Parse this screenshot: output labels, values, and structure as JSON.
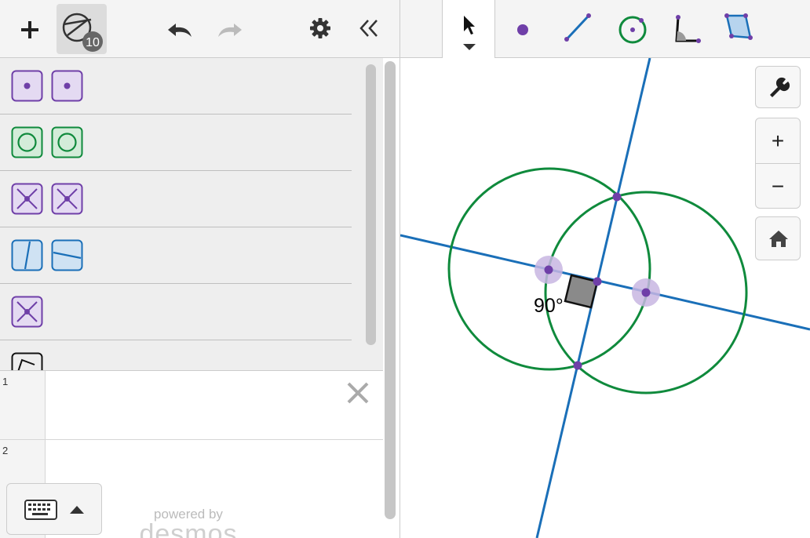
{
  "colors": {
    "circle": "#0f8a3c",
    "line": "#1a6fb8",
    "point": "#6f3fa8",
    "point_highlight": "#c8b6e2"
  },
  "left_toolbar": {
    "add_icon": "plus-icon",
    "geometry_icon": "geometry-tools-icon",
    "geometry_badge": "10",
    "undo_icon": "undo-icon",
    "redo_icon": "redo-icon",
    "settings_icon": "gear-icon",
    "collapse_icon": "double-chevron-left-icon"
  },
  "tool_rows": [
    {
      "icons": [
        "point-tool-icon",
        "point-on-object-icon"
      ]
    },
    {
      "icons": [
        "circle-tool-icon",
        "compass-tool-icon"
      ]
    },
    {
      "icons": [
        "intersection-tool-icon",
        "midpoint-tool-icon"
      ]
    },
    {
      "icons": [
        "parallel-tool-icon",
        "perpendicular-tool-icon"
      ]
    },
    {
      "icons": [
        "center-point-icon"
      ]
    },
    {
      "icons": [
        "angle-tool-icon"
      ]
    }
  ],
  "expressions": [
    {
      "index": "1",
      "value": ""
    },
    {
      "index": "2",
      "value": ""
    }
  ],
  "footer": {
    "powered_by": "powered by",
    "brand": "desmos",
    "keyboard_icon": "keyboard-icon"
  },
  "geo_toolbar": {
    "tools": [
      "select-arrow-icon",
      "point-icon",
      "segment-icon",
      "circle-icon",
      "angle-icon",
      "polygon-icon"
    ]
  },
  "graph_controls": {
    "wrench": "wrench-icon",
    "zoom_in": "+",
    "zoom_out": "−",
    "home": "home-icon"
  },
  "graph": {
    "angle_label": "90°"
  }
}
